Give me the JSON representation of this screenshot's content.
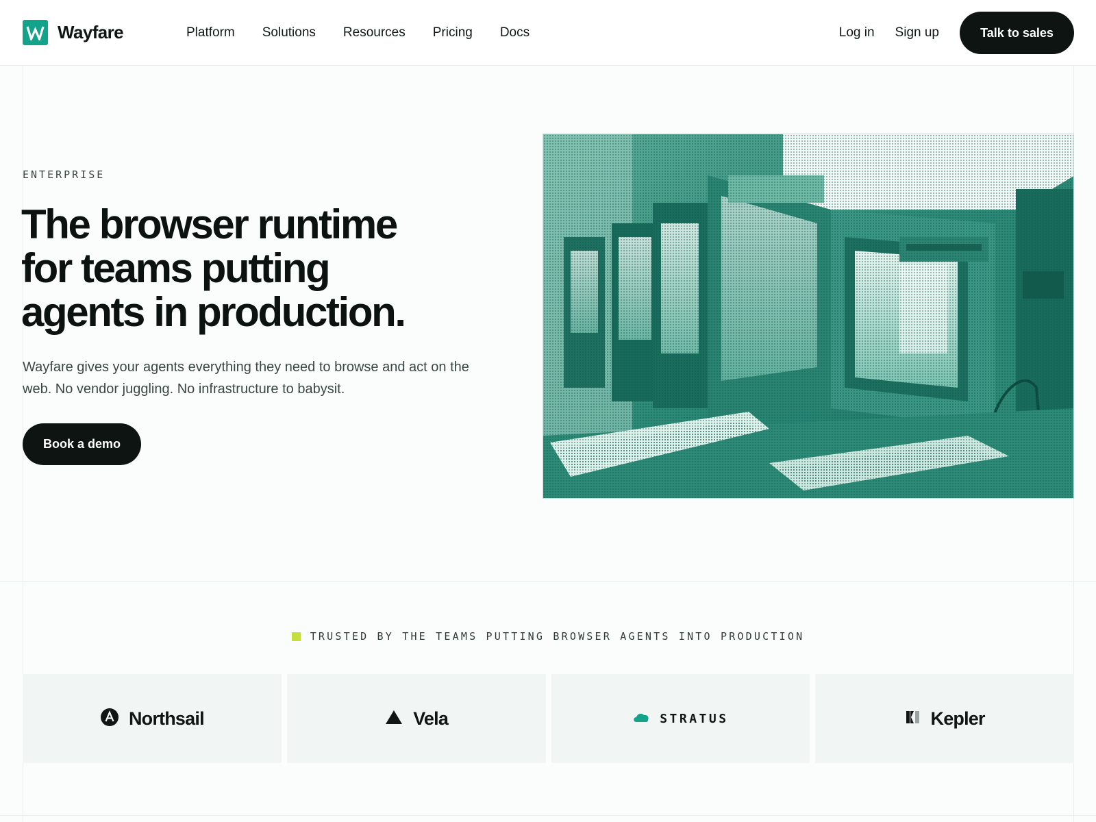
{
  "header": {
    "brand": "Wayfare",
    "nav": [
      {
        "label": "Platform"
      },
      {
        "label": "Solutions"
      },
      {
        "label": "Resources"
      },
      {
        "label": "Pricing"
      },
      {
        "label": "Docs"
      }
    ],
    "login_label": "Log in",
    "signup_label": "Sign up",
    "cta_label": "Talk to sales"
  },
  "hero": {
    "eyebrow": "ENTERPRISE",
    "headline_lines": [
      "The browser runtime",
      "for teams putting",
      "agents in production."
    ],
    "subcopy": "Wayfare gives your agents everything they need to browse and act on the web. No vendor juggling. No infrastructure to babysit.",
    "cta_label": "Book a demo"
  },
  "trusted": {
    "label": "TRUSTED BY THE TEAMS PUTTING BROWSER AGENTS INTO PRODUCTION",
    "logos": [
      {
        "name": "Northsail",
        "icon": "circle-a-icon"
      },
      {
        "name": "Vela",
        "icon": "triangle-icon"
      },
      {
        "name": "STRATUS",
        "icon": "cloud-icon"
      },
      {
        "name": "Kepler",
        "icon": "kepler-icon"
      }
    ]
  },
  "colors": {
    "accent": "#13a38b",
    "dark": "#0e1412",
    "highlight": "#c6dd3e",
    "image_tint": "#137a6a"
  }
}
